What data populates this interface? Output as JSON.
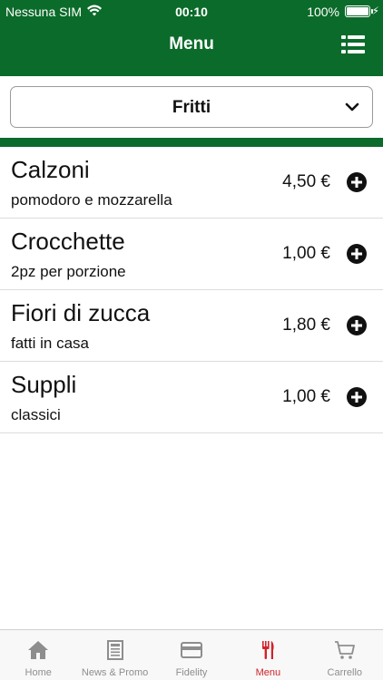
{
  "status_bar": {
    "carrier": "Nessuna SIM",
    "time": "00:10",
    "battery": "100%"
  },
  "header": {
    "title": "Menu",
    "menu_icon": "list-icon"
  },
  "category_picker": {
    "selected": "Fritti",
    "icon": "chevron-down-icon"
  },
  "items": [
    {
      "name": "Calzoni",
      "description": "pomodoro e mozzarella",
      "price": "4,50 €"
    },
    {
      "name": "Crocchette",
      "description": "2pz per porzione",
      "price": "1,00 €"
    },
    {
      "name": "Fiori di zucca",
      "description": "fatti in casa",
      "price": "1,80 €"
    },
    {
      "name": "Suppli",
      "description": "classici",
      "price": "1,00 €"
    }
  ],
  "tabs": [
    {
      "label": "Home",
      "icon": "home-icon"
    },
    {
      "label": "News & Promo",
      "icon": "newspaper-icon"
    },
    {
      "label": "Fidelity",
      "icon": "card-icon"
    },
    {
      "label": "Menu",
      "icon": "fork-knife-icon",
      "active": true
    },
    {
      "label": "Carrello",
      "icon": "cart-icon"
    }
  ],
  "colors": {
    "primary_green": "#0b6b2a",
    "active_tab": "#d0232a",
    "inactive_tab": "#8e8e8e"
  }
}
